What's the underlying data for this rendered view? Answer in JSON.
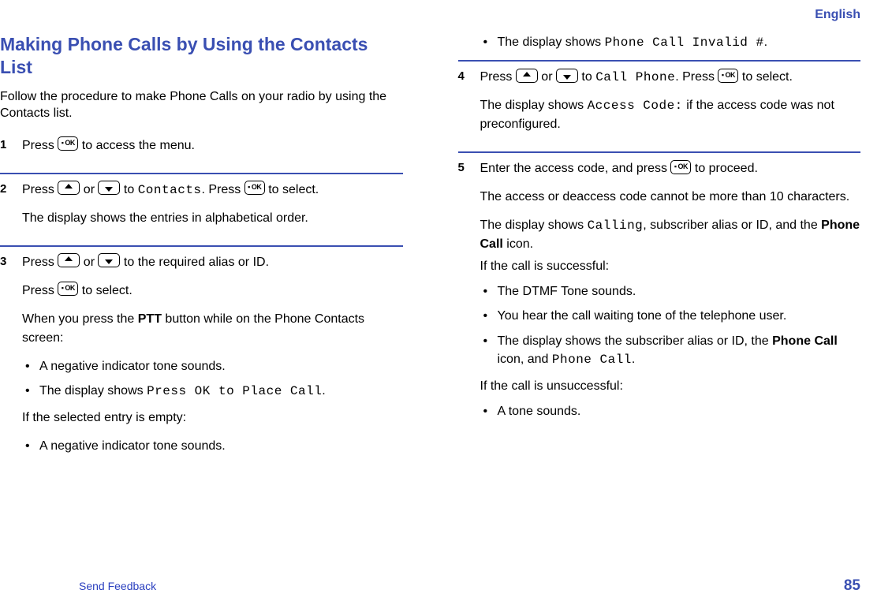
{
  "header": {
    "language": "English"
  },
  "title": "Making Phone Calls by Using the Contacts List",
  "intro": "Follow the procedure to make Phone Calls on your radio by using the Contacts list.",
  "icons": {
    "ok": "▫ OK",
    "up": "▲",
    "down": "▼"
  },
  "labels": {
    "press": "Press ",
    "or": " or ",
    "to_access_menu": " to access the menu.",
    "to": " to ",
    "to_select": " to select.",
    "press_to_select": ". Press ",
    "to_proceed": " to proceed."
  },
  "steps": {
    "s1": {
      "num": "1"
    },
    "s2": {
      "num": "2",
      "target": "Contacts",
      "note": "The display shows the entries in alphabetical order."
    },
    "s3": {
      "num": "3",
      "line1_tail": " to the required alias or ID.",
      "ptt_pre": "When you press the ",
      "ptt_bold": "PTT",
      "ptt_post": " button while on the Phone Contacts screen:",
      "b1": "A negative indicator tone sounds.",
      "b2_pre": "The display shows ",
      "b2_mono": "Press OK to Place Call",
      "b2_post": ".",
      "empty_intro": "If the selected entry is empty:",
      "b3": "A negative indicator tone sounds.",
      "b4_pre": "The display shows ",
      "b4_mono": "Phone Call Invalid #",
      "b4_post": "."
    },
    "s4": {
      "num": "4",
      "target": "Call Phone",
      "note_pre": "The display shows ",
      "note_mono": "Access Code:",
      "note_post": " if the access code was not preconfigured."
    },
    "s5": {
      "num": "5",
      "line1_pre": "Enter the access code, and press ",
      "p2": "The access or deaccess code cannot be more than 10 characters.",
      "p3_pre": "The display shows ",
      "p3_mono": "Calling",
      "p3_mid": ", subscriber alias or ID, and the ",
      "p3_bold": "Phone Call",
      "p3_post": " icon.",
      "p4": "If the call is successful:",
      "b1": "The DTMF Tone sounds.",
      "b2": "You hear the call waiting tone of the telephone user.",
      "b3_pre": "The display shows the subscriber alias or ID, the ",
      "b3_bold": "Phone Call",
      "b3_mid": " icon, and ",
      "b3_mono": "Phone Call",
      "b3_post": ".",
      "p5": "If the call is unsuccessful:",
      "b4": "A tone sounds."
    }
  },
  "footer": {
    "feedback": "Send Feedback",
    "page": "85"
  }
}
